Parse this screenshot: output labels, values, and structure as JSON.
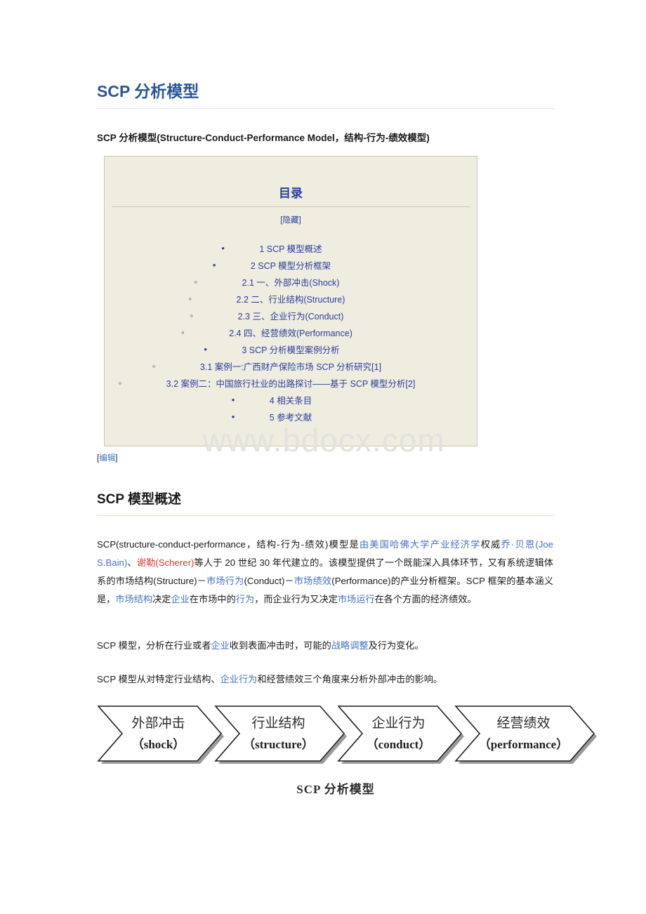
{
  "document": {
    "title": "SCP 分析模型",
    "subtitle": "SCP 分析模型(Structure-Conduct-Performance Model，结构-行为-绩效模型)",
    "watermark": "www.bdocx.com"
  },
  "toc": {
    "heading": "目录",
    "toggle_label": "[隐藏]",
    "items": [
      {
        "level": 1,
        "text": "1 SCP 模型概述"
      },
      {
        "level": 1,
        "text": "2 SCP 模型分析框架"
      },
      {
        "level": 2,
        "text": "2.1  一、外部冲击(Shock)"
      },
      {
        "level": 2,
        "text": "2.2  二、行业结构(Structure)"
      },
      {
        "level": 2,
        "text": "2.3  三、企业行为(Conduct)"
      },
      {
        "level": 2,
        "text": "2.4  四、经营绩效(Performance)"
      },
      {
        "level": 1,
        "text": "3 SCP 分析模型案例分析"
      },
      {
        "level": 2,
        "text": "3.1  案例一:广西财产保险市场 SCP 分析研究[1]"
      },
      {
        "level": 2,
        "text": "3.2  案例二：中国旅行社业的出路探讨——基于 SCP 模型分析[2]"
      },
      {
        "level": 1,
        "text": "4  相关条目"
      },
      {
        "level": 1,
        "text": "5  参考文献"
      }
    ]
  },
  "edit": {
    "open_bracket": "[",
    "label": "编辑",
    "close_bracket": "]"
  },
  "section": {
    "heading": "SCP 模型概述"
  },
  "paragraphs": {
    "p1": {
      "t1": "SCP(structure-conduct-performance，结构-行为-绩效)模型是",
      "l1": "由美国哈佛大学产业经济学",
      "t2": "权威",
      "l2": "乔·贝恩(Joe S.Bain)",
      "t3": "、",
      "l3": "谢勒(Scherer)",
      "t4": "等人于 20 世纪 30 年代建立的。该模型提供了一个既能深入具体环节，又有系统逻辑体系的市场结构(Structure)－",
      "l4": "市场行为",
      "t5": "(Conduct)－",
      "l5": "市场绩效",
      "t6": "(Performance)的产业分析框架。SCP 框架的基本涵义是，",
      "l6": "市场结构",
      "t7": "决定",
      "l7": "企业",
      "t8": "在市场中的",
      "l8": "行为",
      "t9": "，而企业行为又决定",
      "l9": "市场运行",
      "t10": "在各个方面的经济绩效。"
    },
    "p2": {
      "t1": "SCP 模型，分析在行业或者",
      "l1": "企业",
      "t2": "收到表面冲击时，可能的",
      "l2": "战略调整",
      "t3": "及行为变化。"
    },
    "p3": {
      "t1": "SCP 模型从对特定行业结构、",
      "l1": "企业行为",
      "t2": "和经营绩效三个角度来分析外部冲击的影响。"
    }
  },
  "diagram": {
    "caption": "SCP 分析模型",
    "stages": [
      {
        "cn": "外部冲击",
        "en": "（shock）"
      },
      {
        "cn": "行业结构",
        "en": "（structure）"
      },
      {
        "cn": "企业行为",
        "en": "（conduct）"
      },
      {
        "cn": "经营绩效",
        "en": "（performance）"
      }
    ],
    "colors": {
      "fill": "#ffffff",
      "stroke": "#1f1f1f",
      "shadow": "#9a9a9a"
    }
  },
  "colors": {
    "title_blue": "#2a5699",
    "link_blue": "#4472c4",
    "link_red": "#d43b2f",
    "toc_bg": "#efece0",
    "toc_border": "#cfc8ac",
    "toc_text": "#2a3f9d",
    "rule_gray": "#e3e3e3",
    "rule_tan": "#e7dcbe",
    "watermark": "#e2e2de"
  }
}
